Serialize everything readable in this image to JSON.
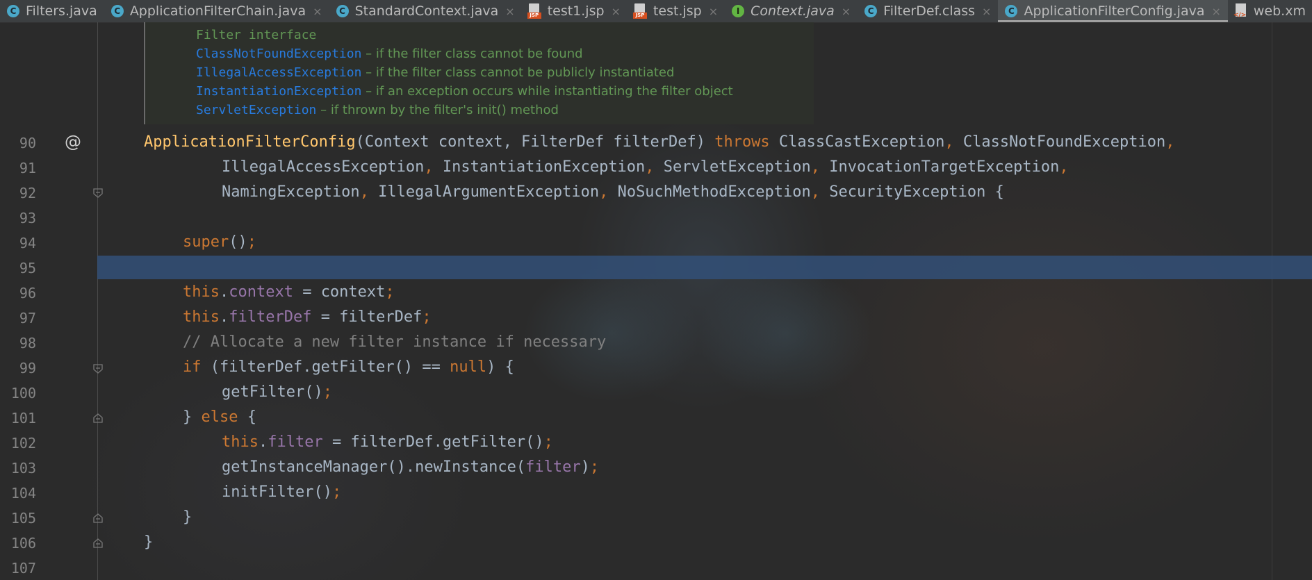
{
  "tabs": [
    {
      "label": "Filters.java",
      "icon": "class-icon"
    },
    {
      "label": "ApplicationFilterChain.java",
      "icon": "class-icon"
    },
    {
      "label": "StandardContext.java",
      "icon": "class-icon"
    },
    {
      "label": "test1.jsp",
      "icon": "jsp-icon"
    },
    {
      "label": "test.jsp",
      "icon": "jsp-icon"
    },
    {
      "label": "Context.java",
      "icon": "interface-icon"
    },
    {
      "label": "FilterDef.class",
      "icon": "class-icon"
    },
    {
      "label": "ApplicationFilterConfig.java",
      "icon": "class-icon",
      "active": true
    },
    {
      "label": "web.xm",
      "icon": "xml-icon"
    }
  ],
  "close_glyph": "×",
  "icon_letters": {
    "class": "C",
    "interface": "I",
    "jsp": "JSP",
    "xml": "</>"
  },
  "javadoc": {
    "line1": "Filter interface",
    "exceptions": [
      {
        "name": "ClassNotFoundException",
        "desc": " – if the filter class cannot be found"
      },
      {
        "name": "IllegalAccessException",
        "desc": " – if the filter class cannot be publicly instantiated"
      },
      {
        "name": "InstantiationException",
        "desc": " – if an exception occurs while instantiating the filter object"
      },
      {
        "name": "ServletException",
        "desc": " – if thrown by the filter's init() method"
      }
    ]
  },
  "gutter": {
    "annotation_glyph": "@"
  },
  "line_numbers": [
    "90",
    "91",
    "92",
    "93",
    "94",
    "95",
    "96",
    "97",
    "98",
    "99",
    "100",
    "101",
    "102",
    "103",
    "104",
    "105",
    "106",
    "107"
  ],
  "code": {
    "l90": {
      "ctor": "ApplicationFilterConfig",
      "params": "(Context context, FilterDef filterDef) ",
      "throws": "throws",
      "ex1": " ClassCastException",
      "c1": ",",
      "ex2": " ClassNotFoundException",
      "c2": ","
    },
    "l91": {
      "ex1": "IllegalAccessException",
      "c1": ",",
      "ex2": " InstantiationException",
      "c2": ",",
      "ex3": " ServletException",
      "c3": ",",
      "ex4": " InvocationTargetException",
      "c4": ","
    },
    "l92": {
      "ex1": "NamingException",
      "c1": ",",
      "ex2": " IllegalArgumentException",
      "c2": ",",
      "ex3": " NoSuchMethodException",
      "c3": ",",
      "ex4": " SecurityException {"
    },
    "l94": {
      "kw": "super",
      "rest": "()",
      "semi": ";"
    },
    "l96": {
      "kw": "this",
      "dot": ".",
      "fld": "context",
      "rest": " = context",
      "semi": ";"
    },
    "l97": {
      "kw": "this",
      "dot": ".",
      "fld": "filterDef",
      "rest": " = filterDef",
      "semi": ";"
    },
    "l98": {
      "comment": "// Allocate a new filter instance if necessary"
    },
    "l99": {
      "kw": "if",
      "a": " (filterDef.getFilter() == ",
      "null": "null",
      "b": ") {"
    },
    "l100": {
      "text": "getFilter()",
      "semi": ";"
    },
    "l101": {
      "a": "} ",
      "kw": "else",
      "b": " {"
    },
    "l102": {
      "kw": "this",
      "dot": ".",
      "fld": "filter",
      "rest": " = filterDef.getFilter()",
      "semi": ";"
    },
    "l103": {
      "a": "getInstanceManager().newInstance(",
      "fld": "filter",
      "b": ")",
      "semi": ";"
    },
    "l104": {
      "text": "initFilter()",
      "semi": ";"
    },
    "l105": {
      "text": "}"
    },
    "l106": {
      "text": "}"
    }
  },
  "colors": {
    "background": "#2b2b2b",
    "keyword": "#cc7832",
    "method_decl": "#ffc66d",
    "field": "#9876aa",
    "comment": "#808080",
    "javadoc_text": "#629755",
    "javadoc_link": "#287bde",
    "caret_row": "#324a6e"
  }
}
